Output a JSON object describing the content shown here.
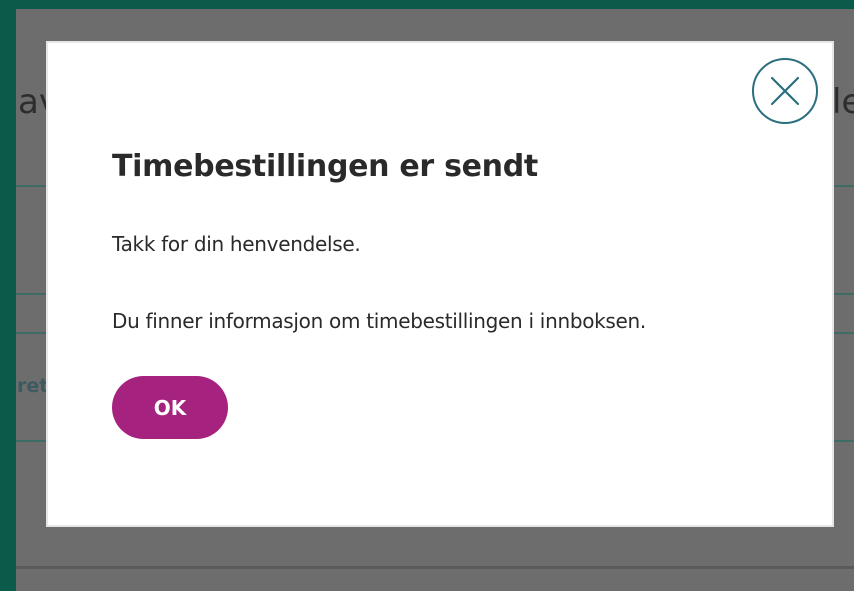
{
  "background": {
    "fragment_left": "av",
    "fragment_right": "le",
    "fragment_row": "ret"
  },
  "modal": {
    "close_icon": "close-circle-icon",
    "title": "Timebestillingen er sendt",
    "paragraph1": "Takk for din henvendelse.",
    "paragraph2": "Du finner informasjon om timebestillingen i innboksen.",
    "ok_label": "OK"
  },
  "colors": {
    "frame": "#0b5a4a",
    "overlay": "#6d6d6d",
    "accent_button": "#a5237e",
    "close_icon": "#2b6f7f"
  }
}
